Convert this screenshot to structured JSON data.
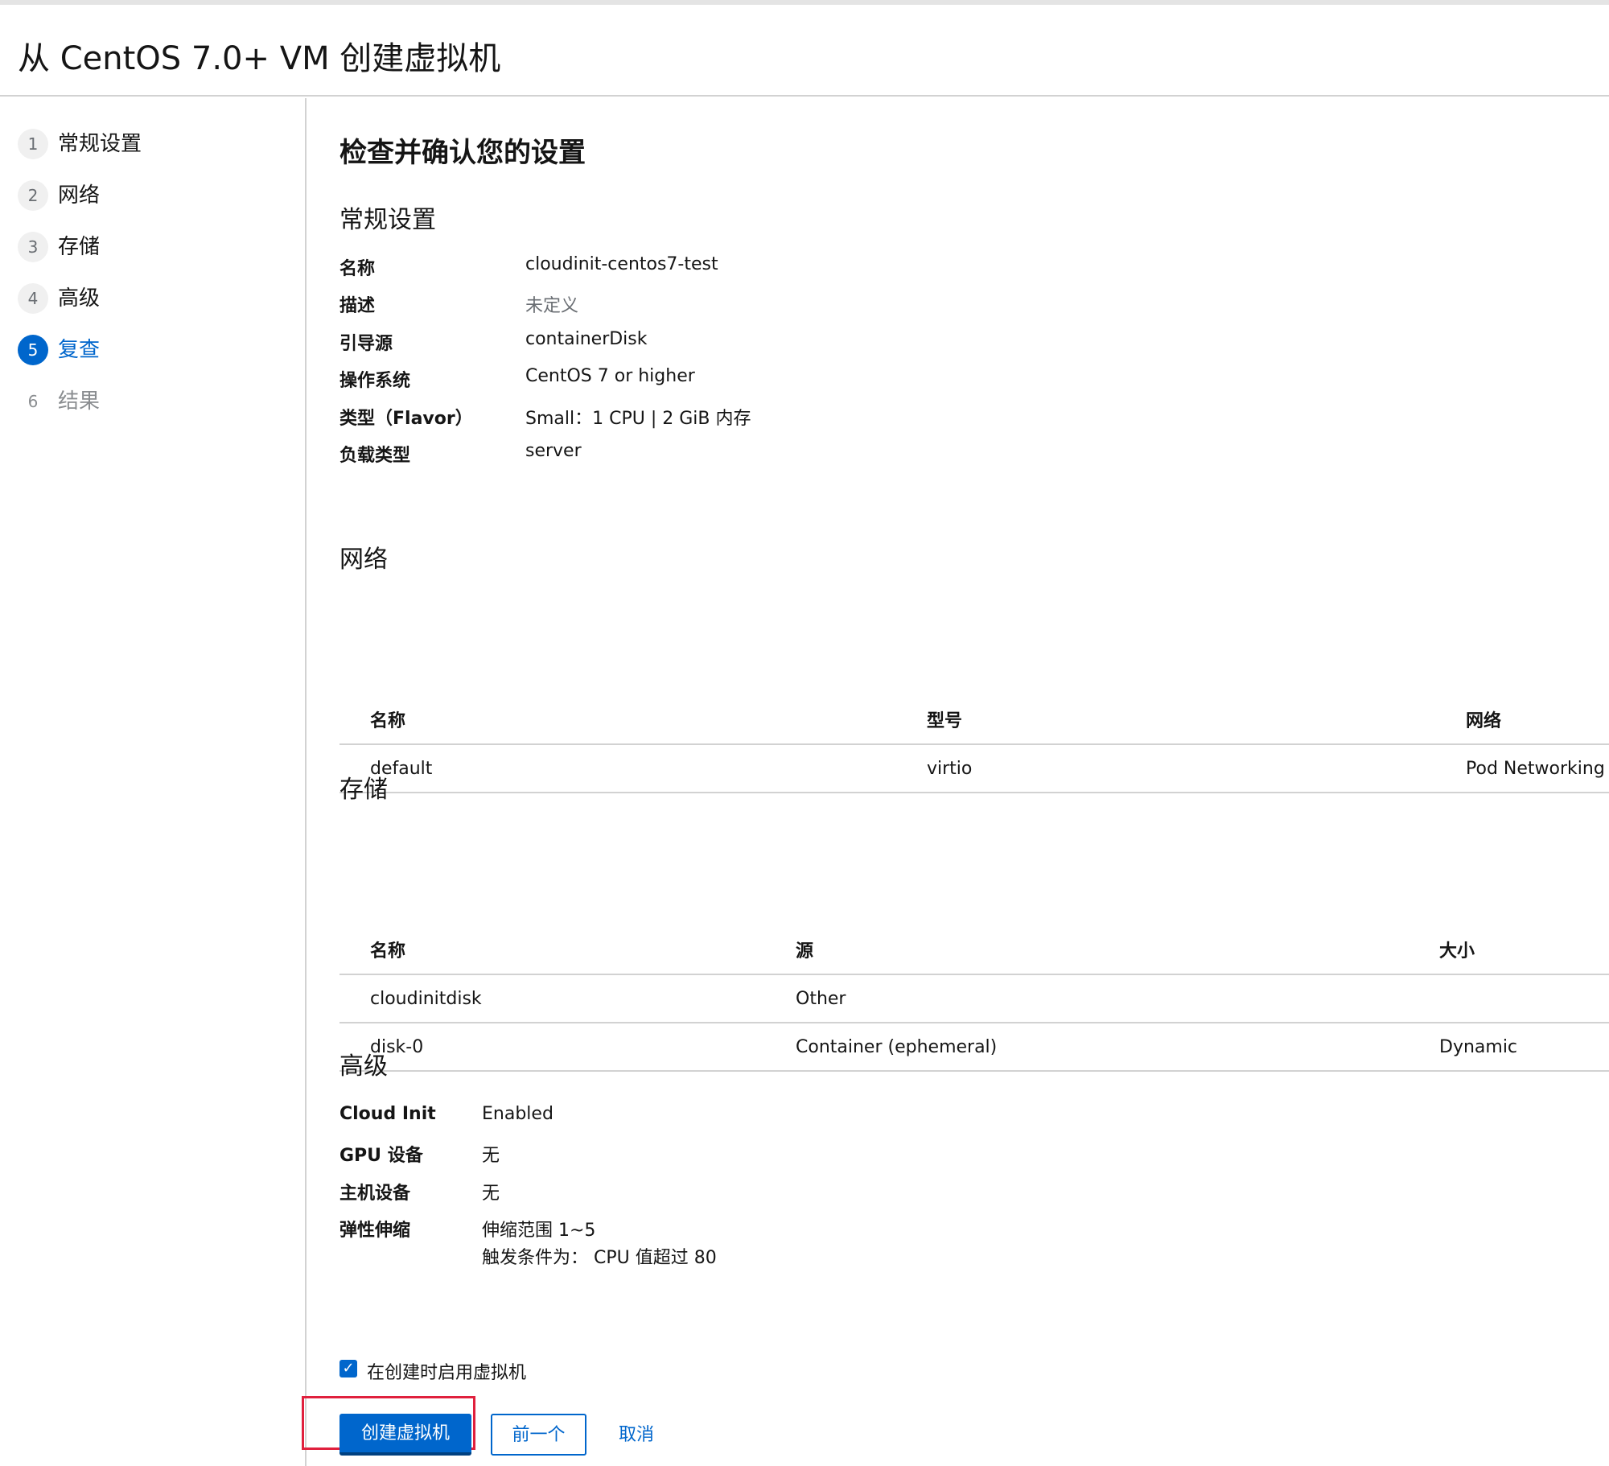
{
  "page": {
    "title": "从 CentOS 7.0+ VM 创建虚拟机"
  },
  "wizard": {
    "steps": [
      {
        "num": "1",
        "label": "常规设置"
      },
      {
        "num": "2",
        "label": "网络"
      },
      {
        "num": "3",
        "label": "存储"
      },
      {
        "num": "4",
        "label": "高级"
      },
      {
        "num": "5",
        "label": "复查"
      },
      {
        "num": "6",
        "label": "结果"
      }
    ]
  },
  "review": {
    "title": "检查并确认您的设置",
    "general": {
      "title": "常规设置",
      "rows": [
        {
          "term": "名称",
          "value": "cloudinit-centos7-test"
        },
        {
          "term": "描述",
          "value": "未定义"
        },
        {
          "term": "引导源",
          "value": "containerDisk"
        },
        {
          "term": "操作系统",
          "value": "CentOS 7 or higher"
        },
        {
          "term": "类型（Flavor）",
          "value": "Small：1 CPU | 2 GiB 内存"
        },
        {
          "term": "负载类型",
          "value": "server"
        }
      ]
    },
    "network": {
      "title": "网络",
      "headers": [
        "名称",
        "型号",
        "网络"
      ],
      "rows": [
        [
          "default",
          "virtio",
          "Pod Networking"
        ]
      ]
    },
    "storage": {
      "title": "存储",
      "headers": [
        "名称",
        "源",
        "大小"
      ],
      "rows": [
        [
          "cloudinitdisk",
          "Other",
          ""
        ],
        [
          "disk-0",
          "Container (ephemeral)",
          "Dynamic"
        ]
      ]
    },
    "advanced": {
      "title": "高级",
      "rows": [
        {
          "term": "Cloud Init",
          "value": "Enabled"
        },
        {
          "term": "GPU 设备",
          "value": "无"
        },
        {
          "term": "主机设备",
          "value": "无"
        },
        {
          "term": "弹性伸缩",
          "value": "伸缩范围 1~5",
          "value2": "触发条件为： CPU 值超过 80"
        }
      ]
    }
  },
  "footer": {
    "start_on_create_label": "在创建时启用虚拟机",
    "checked": true,
    "create_label": "创建虚拟机",
    "back_label": "前一个",
    "cancel_label": "取消"
  },
  "colors": {
    "accent": "#0066cc",
    "highlight": "#e0203d",
    "border": "#d2d2d2"
  }
}
